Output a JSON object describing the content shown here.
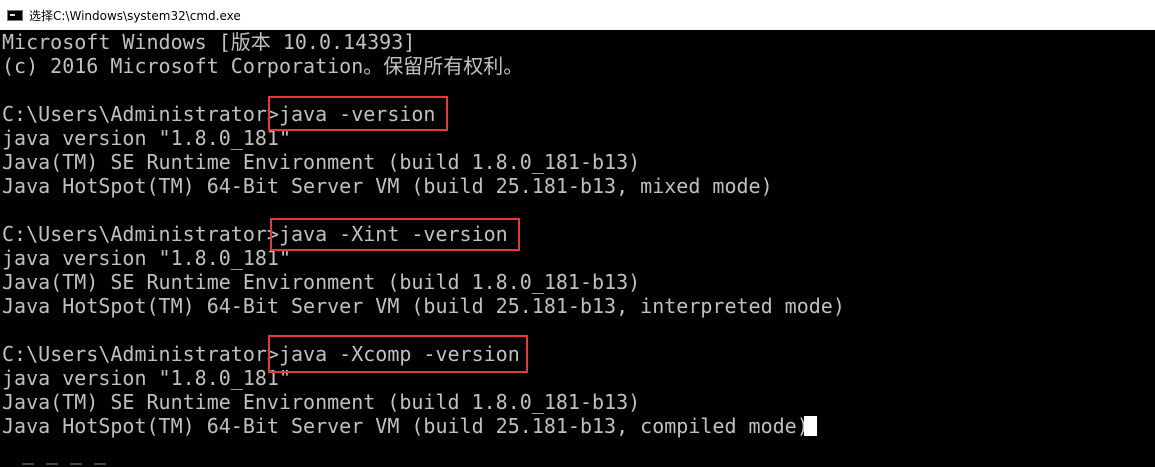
{
  "window": {
    "title": "选择C:\\Windows\\system32\\cmd.exe",
    "icon": "cmd-console-icon"
  },
  "console": {
    "lines": [
      "Microsoft Windows [版本 10.0.14393]",
      "(c) 2016 Microsoft Corporation。保留所有权利。",
      "",
      "C:\\Users\\Administrator>java -version",
      "java version \"1.8.0_181\"",
      "Java(TM) SE Runtime Environment (build 1.8.0_181-b13)",
      "Java HotSpot(TM) 64-Bit Server VM (build 25.181-b13, mixed mode)",
      "",
      "C:\\Users\\Administrator>java -Xint -version",
      "java version \"1.8.0_181\"",
      "Java(TM) SE Runtime Environment (build 1.8.0_181-b13)",
      "Java HotSpot(TM) 64-Bit Server VM (build 25.181-b13, interpreted mode)",
      "",
      "C:\\Users\\Administrator>java -Xcomp -version",
      "java version \"1.8.0_181\"",
      "Java(TM) SE Runtime Environment (build 1.8.0_181-b13)",
      "Java HotSpot(TM) 64-Bit Server VM (build 25.181-b13, compiled mode)"
    ]
  },
  "colors": {
    "background": "#000000",
    "text": "#c0c0c0",
    "highlight": "#e53935",
    "cursor": "#ffffff"
  }
}
